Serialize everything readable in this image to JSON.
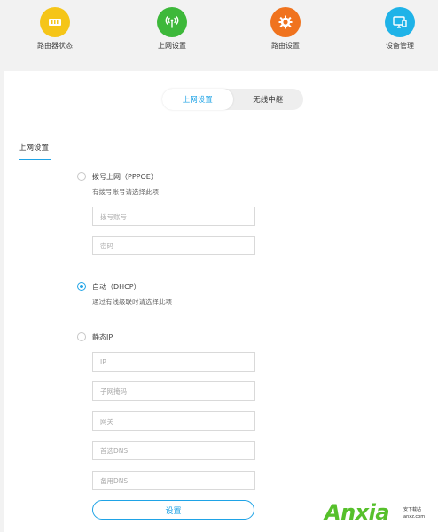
{
  "nav": {
    "items": [
      {
        "label": "路由器状态",
        "icon": "router-status-icon",
        "color": "#f5c518"
      },
      {
        "label": "上网设置",
        "icon": "wifi-antenna-icon",
        "color": "#3db83a"
      },
      {
        "label": "路由设置",
        "icon": "gear-icon",
        "color": "#f0731e"
      },
      {
        "label": "设备管理",
        "icon": "device-screen-icon",
        "color": "#1fb3e8"
      }
    ],
    "active_index": 1
  },
  "tabs": {
    "items": [
      "上网设置",
      "无线中继"
    ],
    "active_index": 0
  },
  "section": {
    "title": "上网设置"
  },
  "options": {
    "pppoe": {
      "label": "拨号上网（PPPOE）",
      "desc": "有拨号账号请选择此项",
      "checked": false,
      "account_placeholder": "拨号账号",
      "password_placeholder": "密码"
    },
    "dhcp": {
      "label": "自动（DHCP）",
      "desc": "通过有线级联时请选择此项",
      "checked": true
    },
    "static": {
      "label": "静态IP",
      "checked": false,
      "ip_placeholder": "IP",
      "mask_placeholder": "子网掩码",
      "gateway_placeholder": "网关",
      "dns1_placeholder": "首选DNS",
      "dns2_placeholder": "备用DNS"
    }
  },
  "save_label": "设置",
  "watermark": {
    "brand": "Anxia",
    "tagline": "安下载站",
    "url": "anxz.com"
  },
  "colors": {
    "accent": "#1fa3e6",
    "brand_green": "#56c02b"
  }
}
